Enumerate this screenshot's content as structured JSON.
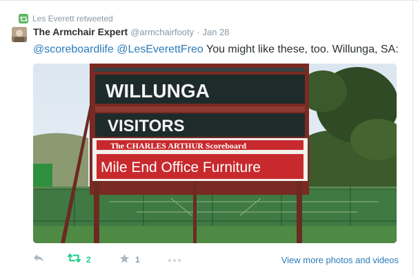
{
  "retweet_context": {
    "text": "Les Everett retweeted",
    "icon": "retweet-icon",
    "color": "#5eb862"
  },
  "tweet": {
    "fullname": "The Armchair Expert",
    "username": "@armchairfooty",
    "separator": "·",
    "time": "Jan 28",
    "mention1": "@scoreboardlife",
    "mention2": "@LesEverettFreo",
    "text_rest": " You might like these, too. Willunga, SA:"
  },
  "media": {
    "board_lines": [
      "WILLUNGA",
      "VISITORS",
      "The CHARLES ARTHUR Scoreboard",
      "Mile End Office Furniture"
    ]
  },
  "actions": {
    "reply_icon": "reply-icon",
    "retweet_icon": "retweet-icon",
    "retweet_count": "2",
    "favorite_icon": "star-icon",
    "favorite_count": "1",
    "more_icon": "more-icon",
    "view_more_label": "View more photos and videos"
  },
  "colors": {
    "link": "#2b7bb9",
    "retweet_active": "#19cf86",
    "muted": "#8899a6"
  }
}
